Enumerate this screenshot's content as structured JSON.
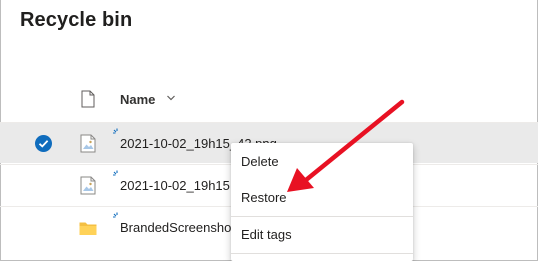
{
  "page": {
    "title": "Recycle bin"
  },
  "list": {
    "header": {
      "name_label": "Name"
    },
    "rows": [
      {
        "name": "2021-10-02_19h15_42.png",
        "type": "image",
        "selected": true
      },
      {
        "name": "2021-10-02_19h15",
        "type": "image",
        "selected": false
      },
      {
        "name": "BrandedScreensho",
        "type": "folder",
        "selected": false
      }
    ]
  },
  "context_menu": {
    "items": [
      {
        "label": "Delete"
      },
      {
        "label": "Restore"
      },
      {
        "label": "Edit tags"
      }
    ]
  },
  "colors": {
    "accent": "#0f6cbd",
    "arrow": "#e81123",
    "selected_row": "#eaeaea"
  },
  "icons": {
    "header": "file-icon",
    "sort": "chevron-down-icon",
    "image": "image-file-icon",
    "folder": "folder-icon",
    "new": "new-sparkle-icon",
    "check": "checkmark-icon"
  }
}
